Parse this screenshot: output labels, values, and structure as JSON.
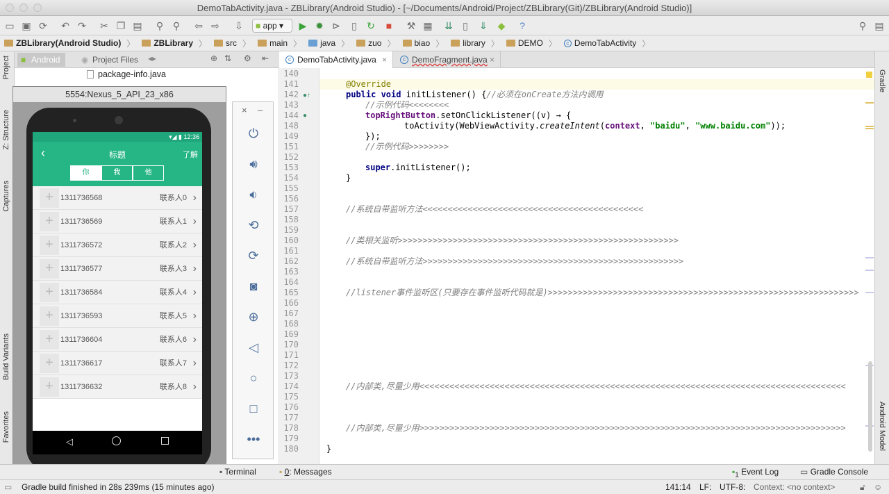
{
  "window": {
    "title": "DemoTabActivity.java - ZBLibrary(Android Studio) - [~/Documents/Android/Project/ZBLibrary(Git)/ZBLibrary(Android Studio)]"
  },
  "toolbar": {
    "run_config": "app"
  },
  "breadcrumbs": [
    "ZBLibrary(Android Studio)",
    "ZBLibrary",
    "src",
    "main",
    "java",
    "zuo",
    "biao",
    "library",
    "DEMO",
    "DemoTabActivity"
  ],
  "project": {
    "tab_android": "Android",
    "tab_project_files": "Project Files",
    "file": "package-info.java"
  },
  "left_tools": [
    "Project",
    "Z: Structure",
    "Captures",
    "Build Variants",
    "Favorites"
  ],
  "right_tools": [
    "Gradle",
    "Android Model"
  ],
  "editor": {
    "tabs": [
      "DemoTabActivity.java",
      "DemoFragment.java"
    ],
    "lines": [
      "140",
      "141",
      "142",
      "143",
      "144",
      "148",
      "149",
      "151",
      "152",
      "153",
      "154",
      "155",
      "156",
      "157",
      "158",
      "159",
      "160",
      "161",
      "162",
      "163",
      "164",
      "165",
      "166",
      "167",
      "168",
      "169",
      "170",
      "171",
      "172",
      "173",
      "174",
      "175",
      "176",
      "177",
      "178",
      "179",
      "180"
    ],
    "code": {
      "l141": "@Override",
      "l142a": "public void ",
      "l142b": "initListener() {",
      "l142c": "//必须在onCreate方法内调用",
      "l143": "//示例代码<<<<<<<<",
      "l144a": "topRightButton",
      ".": "",
      "l144b": ".setOnClickListener((v) → {",
      "l148a": "toActivity(WebViewActivity.",
      "l148b": "createIntent",
      "l148c": "(",
      "l148d": "context",
      ", ": "",
      "l148e": "\"baidu\"",
      "l148f": ", ",
      "l148g": "\"www.baidu.com\"",
      "l148h": "));",
      "l149": "});",
      "l151": "//示例代码>>>>>>>>",
      "l153a": "super",
      "l153b": ".initListener();",
      "l154": "}",
      "l157": "//系统自带监听方法<<<<<<<<<<<<<<<<<<<<<<<<<<<<<<<<<<<<<<<<<<<<",
      "l160": "//类相关监听>>>>>>>>>>>>>>>>>>>>>>>>>>>>>>>>>>>>>>>>>>>>>>>>>>>>>>>>",
      "l162": "//系统自带监听方法>>>>>>>>>>>>>>>>>>>>>>>>>>>>>>>>>>>>>>>>>>>>>>>>>>>>",
      "l165": "//listener事件监听区(只要存在事件监听代码就是)>>>>>>>>>>>>>>>>>>>>>>>>>>>>>>>>>>>>>>>>>>>>>>>>>>>>>>>>>>>>>>",
      "l174": "//内部类,尽量少用<<<<<<<<<<<<<<<<<<<<<<<<<<<<<<<<<<<<<<<<<<<<<<<<<<<<<<<<<<<<<<<<<<<<<<<<<<<<<<<<<<<<<",
      "l178": "//内部类,尽量少用>>>>>>>>>>>>>>>>>>>>>>>>>>>>>>>>>>>>>>>>>>>>>>>>>>>>>>>>>>>>>>>>>>>>>>>>>>>>>>>>>>>>>",
      "l180": "}"
    }
  },
  "emulator": {
    "title": "5554:Nexus_5_API_23_x86",
    "time": "12:36",
    "app_title": "标题",
    "app_action": "了解",
    "tabs": [
      "你",
      "我",
      "他"
    ],
    "contacts": [
      {
        "phone": "1311736568",
        "name": "联系人0"
      },
      {
        "phone": "1311736569",
        "name": "联系人1"
      },
      {
        "phone": "1311736572",
        "name": "联系人2"
      },
      {
        "phone": "1311736577",
        "name": "联系人3"
      },
      {
        "phone": "1311736584",
        "name": "联系人4"
      },
      {
        "phone": "1311736593",
        "name": "联系人5"
      },
      {
        "phone": "1311736604",
        "name": "联系人6"
      },
      {
        "phone": "1311736617",
        "name": "联系人7"
      },
      {
        "phone": "1311736632",
        "name": "联系人8"
      }
    ]
  },
  "bottom": {
    "terminal": "Terminal",
    "messages_num": "0",
    "messages": ": Messages",
    "event_num": "1",
    "event_log": "Event Log",
    "gradle_console": "Gradle Console"
  },
  "status": {
    "message": "Gradle build finished in 28s 239ms (15 minutes ago)",
    "position": "141:14",
    "line_sep": "LF:",
    "encoding": "UTF-8:",
    "context": "Context: <no context>"
  }
}
